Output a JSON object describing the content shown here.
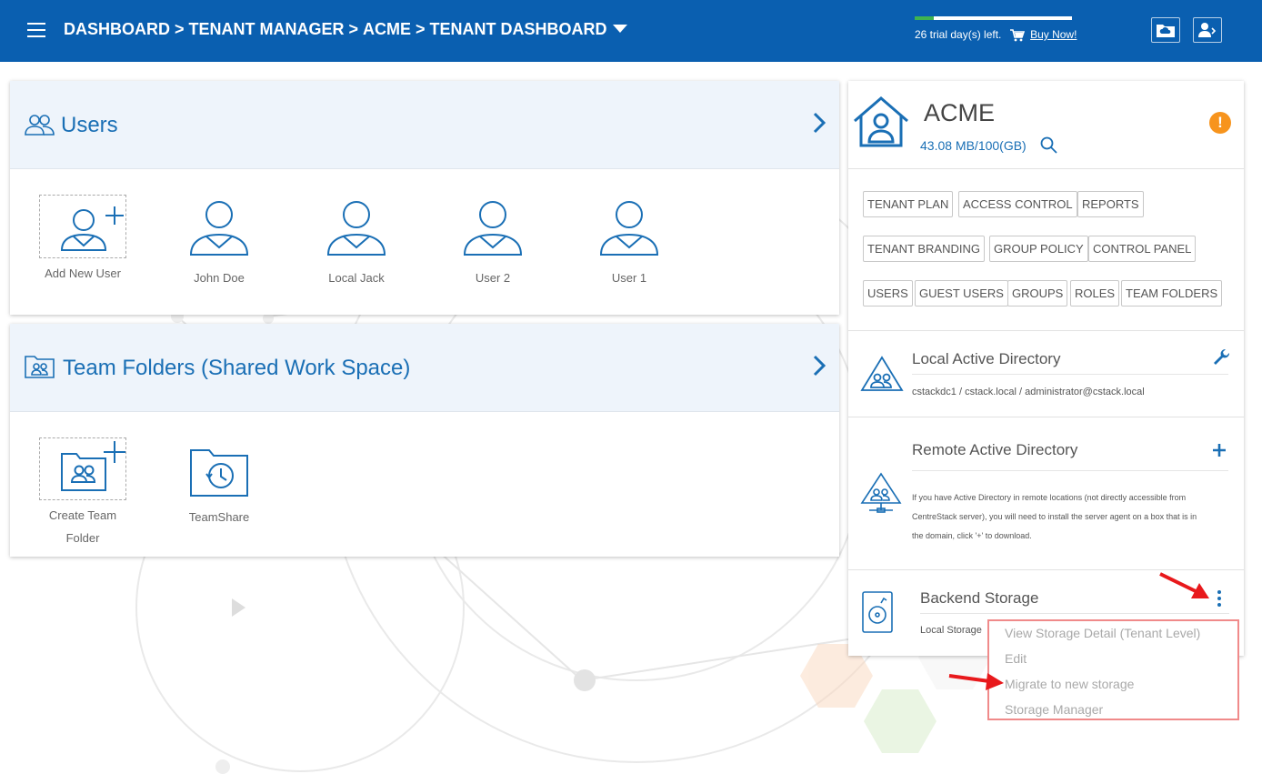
{
  "header": {
    "breadcrumb": [
      "DASHBOARD",
      "TENANT MANAGER",
      "ACME",
      "TENANT DASHBOARD"
    ],
    "separator": ">",
    "trial_text": "26 trial day(s) left.",
    "buy_now": "Buy Now!",
    "trial_progress_fraction": 0.12,
    "icons": [
      "menu-icon",
      "cart-icon",
      "cloud-folder-icon",
      "user-switch-icon"
    ]
  },
  "users_panel": {
    "title": "Users",
    "items": [
      {
        "label": "Add New User"
      },
      {
        "label": "John Doe"
      },
      {
        "label": "Local Jack"
      },
      {
        "label": "User 2"
      },
      {
        "label": "User 1"
      }
    ]
  },
  "team_folders_panel": {
    "title": "Team Folders (Shared Work Space)",
    "items": [
      {
        "label": "Create Team Folder"
      },
      {
        "label": "TeamShare"
      }
    ]
  },
  "tenant": {
    "name": "ACME",
    "storage_used": "43.08 MB/100(GB)",
    "warning_symbol": "!",
    "tags_row1": [
      "TENANT PLAN",
      "ACCESS CONTROL",
      "REPORTS"
    ],
    "tags_row2": [
      "TENANT BRANDING",
      "GROUP POLICY",
      "CONTROL PANEL"
    ],
    "tags_row3": [
      "USERS",
      "GUEST USERS",
      "GROUPS",
      "ROLES",
      "TEAM FOLDERS"
    ]
  },
  "local_ad": {
    "title": "Local Active Directory",
    "detail": "cstackdc1 / cstack.local / administrator@cstack.local"
  },
  "remote_ad": {
    "title": "Remote Active Directory",
    "note_lines": [
      "If you have Active Directory in remote locations (not directly accessible from",
      "CentreStack server), you will need to install the server agent on a box that is in",
      "the domain, click '+' to download."
    ]
  },
  "backend_storage": {
    "title": "Backend Storage",
    "detail": "Local Storage"
  },
  "storage_menu": {
    "items": [
      "View Storage Detail (Tenant Level)",
      "Edit",
      "Migrate to new storage",
      "Storage Manager"
    ]
  },
  "colors": {
    "header_bg": "#0a5fb0",
    "accent": "#1a6fb5",
    "warning": "#f7941d",
    "annotation_arrow": "#e8191c",
    "menu_border": "#f08a8a"
  }
}
